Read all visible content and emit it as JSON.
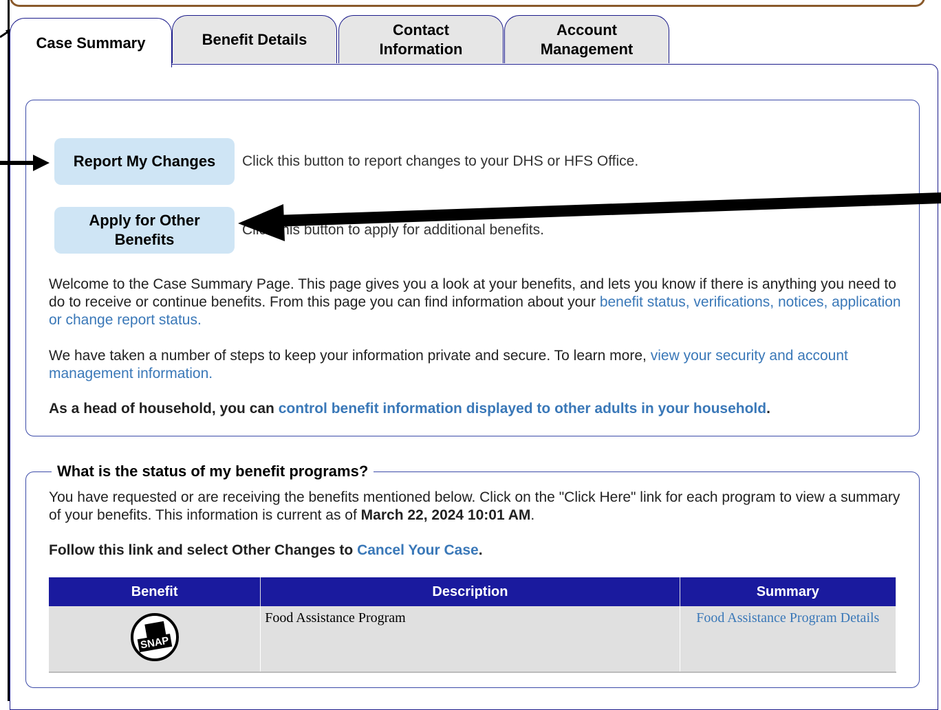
{
  "tabs": [
    {
      "label": "Case Summary"
    },
    {
      "label": "Benefit Details"
    },
    {
      "label": "Contact Information"
    },
    {
      "label": "Account Management"
    }
  ],
  "actions": {
    "report_label": "Report My Changes",
    "report_desc": "Click this button to report changes to your DHS or HFS Office.",
    "apply_label": "Apply for Other Benefits",
    "apply_desc": "Click this button to apply for additional benefits."
  },
  "intro": {
    "welcome_text": "Welcome to the Case Summary Page. This page gives you a look at your benefits, and lets you know if there is anything you need to do to receive or continue benefits. From this page you can find information about your",
    "welcome_link": "benefit status, verifications, notices, application or change report status",
    "security_text": "We have taken a number of steps to keep your information private and secure. To learn more,",
    "security_link": "view your security and account management information",
    "household_text": "As a head of household, you can",
    "household_link": "control benefit information displayed to other adults in your household"
  },
  "status": {
    "legend": "What is the status of my benefit programs?",
    "text": "You have requested or are receiving the benefits mentioned below. Click on the \"Click Here\" link for each program to view a summary of your benefits. This information is current as of",
    "timestamp": "March 22, 2024 10:01 AM",
    "cancel_text": "Follow this link and select Other Changes to",
    "cancel_link": "Cancel Your Case"
  },
  "table": {
    "headers": [
      "Benefit",
      "Description",
      "Summary"
    ],
    "rows": [
      {
        "icon": "snap-logo-icon",
        "icon_text": "SNAP",
        "description": "Food Assistance Program",
        "summary_link": "Food Assistance Program Details"
      }
    ]
  }
}
